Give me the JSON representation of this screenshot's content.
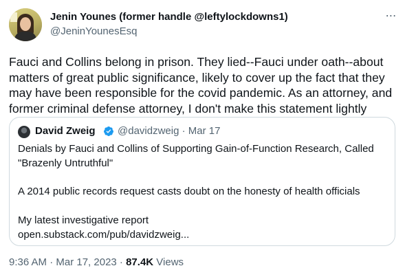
{
  "author": {
    "display_name": "Jenin Younes (former handle @leftylockdowns1)",
    "handle": "@JeninYounesEsq"
  },
  "more_icon": "⋯",
  "body_lines": [
    "Fauci and Collins belong in prison.  They lied--Fauci under oath--about",
    "matters of great public significance, likely to cover up the fact that they",
    "may have been responsible for the covid pandemic.  As an attorney, and",
    "former criminal defense attorney, I don't make this statement lightly"
  ],
  "quote": {
    "display_name": "David Zweig",
    "verified_icon": "verified-badge-icon",
    "handle_date": "@davidzweig · Mar 17",
    "lines": [
      "Denials by Fauci and Collins of Supporting Gain-of-Function Research, Called",
      "\"Brazenly Untruthful\"",
      "",
      "A 2014 public records request casts doubt on the honesty of health officials",
      "",
      "My latest investigative report",
      "open.substack.com/pub/davidzweig..."
    ]
  },
  "meta": {
    "timestamp": "9:36 AM · Mar 17, 2023 · ",
    "views_count": "87.4K",
    "views_label": " Views"
  },
  "colors": {
    "text": "#0f1419",
    "secondary": "#536471",
    "border": "#cfd9de",
    "verified": "#1d9bf0"
  }
}
